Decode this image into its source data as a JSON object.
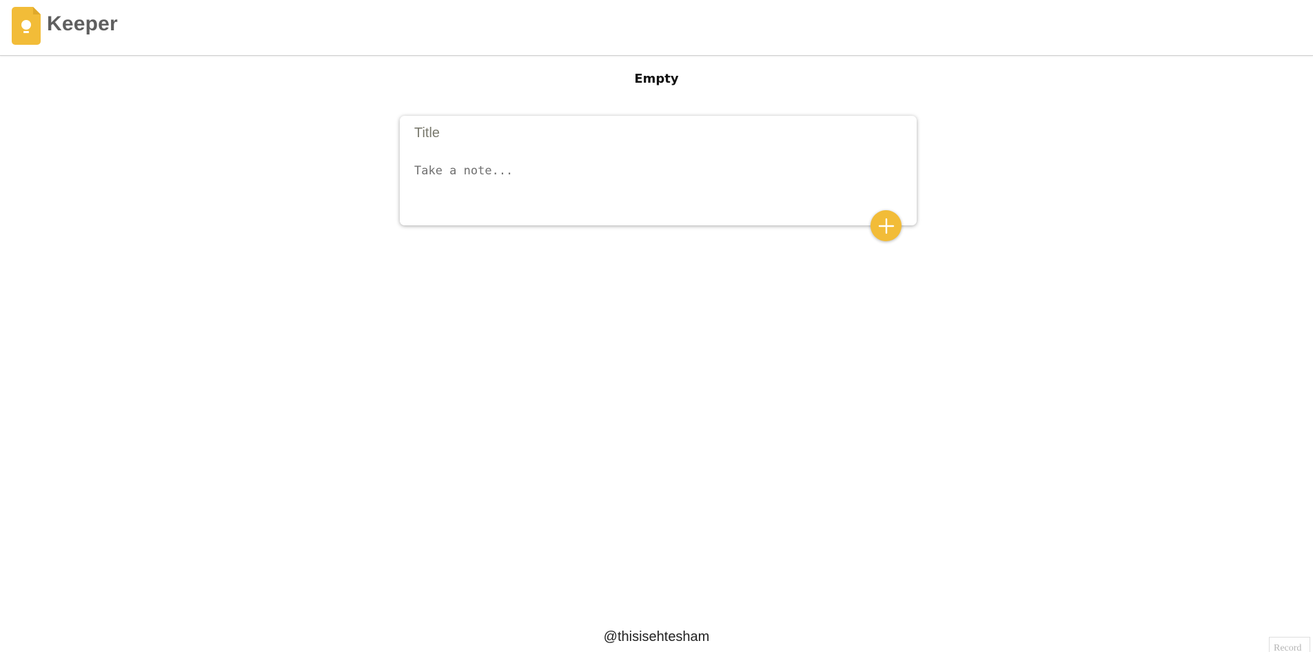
{
  "header": {
    "brand": "Keeper",
    "logo_icon": "keep-note-lightbulb-icon",
    "accent_color": "#f2bc38"
  },
  "main": {
    "status_text": "Empty"
  },
  "note_form": {
    "title_placeholder": "Title",
    "title_value": "",
    "content_placeholder": "Take a note...",
    "content_value": "",
    "add_button_icon": "plus-icon"
  },
  "footer": {
    "credit": "@thisisehtesham"
  },
  "corner_widget": {
    "label": "Record"
  }
}
